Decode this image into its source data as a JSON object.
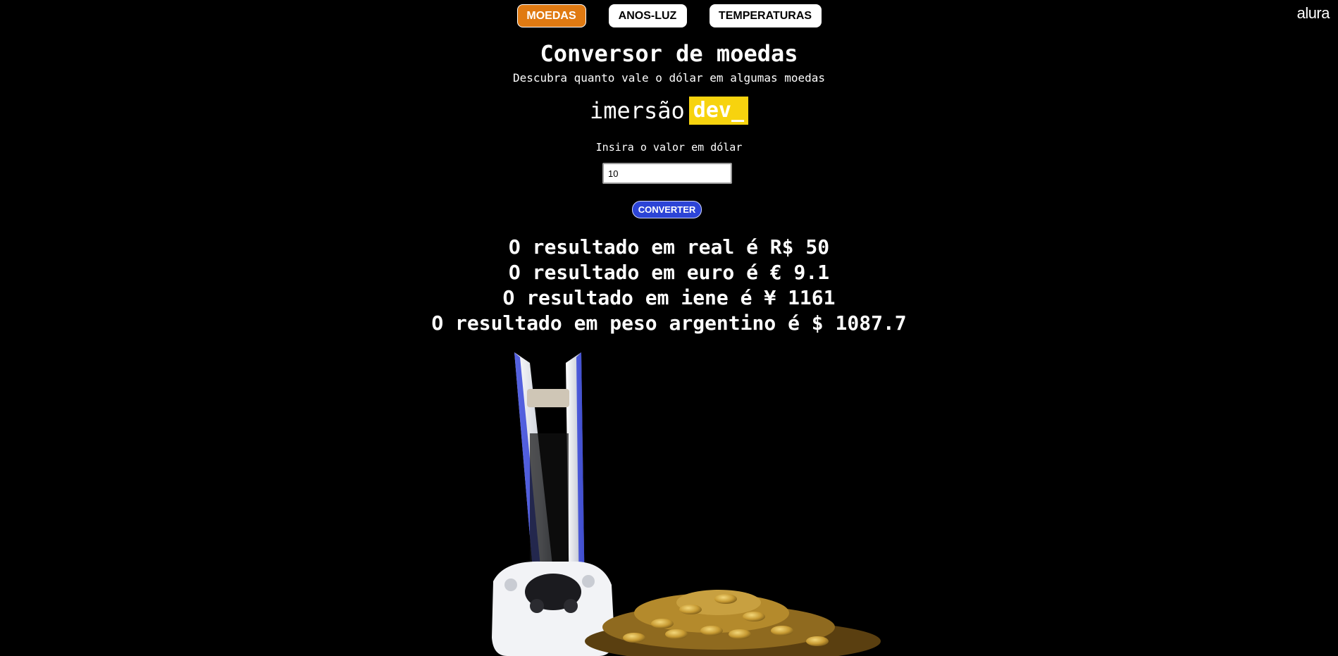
{
  "nav": {
    "items": [
      {
        "label": "MOEDAS",
        "active": true
      },
      {
        "label": "ANOS-LUZ",
        "active": false
      },
      {
        "label": "TEMPERATURAS",
        "active": false
      }
    ]
  },
  "brand": "alura",
  "header": {
    "title": "Conversor de moedas",
    "subtitle": "Descubra quanto vale o dólar em algumas moedas"
  },
  "logo": {
    "left": "imersão",
    "right": "dev_"
  },
  "form": {
    "label": "Insira o valor em dólar",
    "value": "10",
    "button_label": "CONVERTER"
  },
  "results": [
    "O resultado em real é R$ 50",
    "O resultado em euro é € 9.1",
    "O resultado em iene é ¥ 1161",
    "O resultado em peso argentino é $ 1087.7"
  ],
  "colors": {
    "background": "#000000",
    "active_tab": "#e07a12",
    "button": "#2c44d6",
    "logo_accent": "#f7d30e"
  },
  "image": {
    "subject": "game console with controller and pile of gold coins"
  }
}
